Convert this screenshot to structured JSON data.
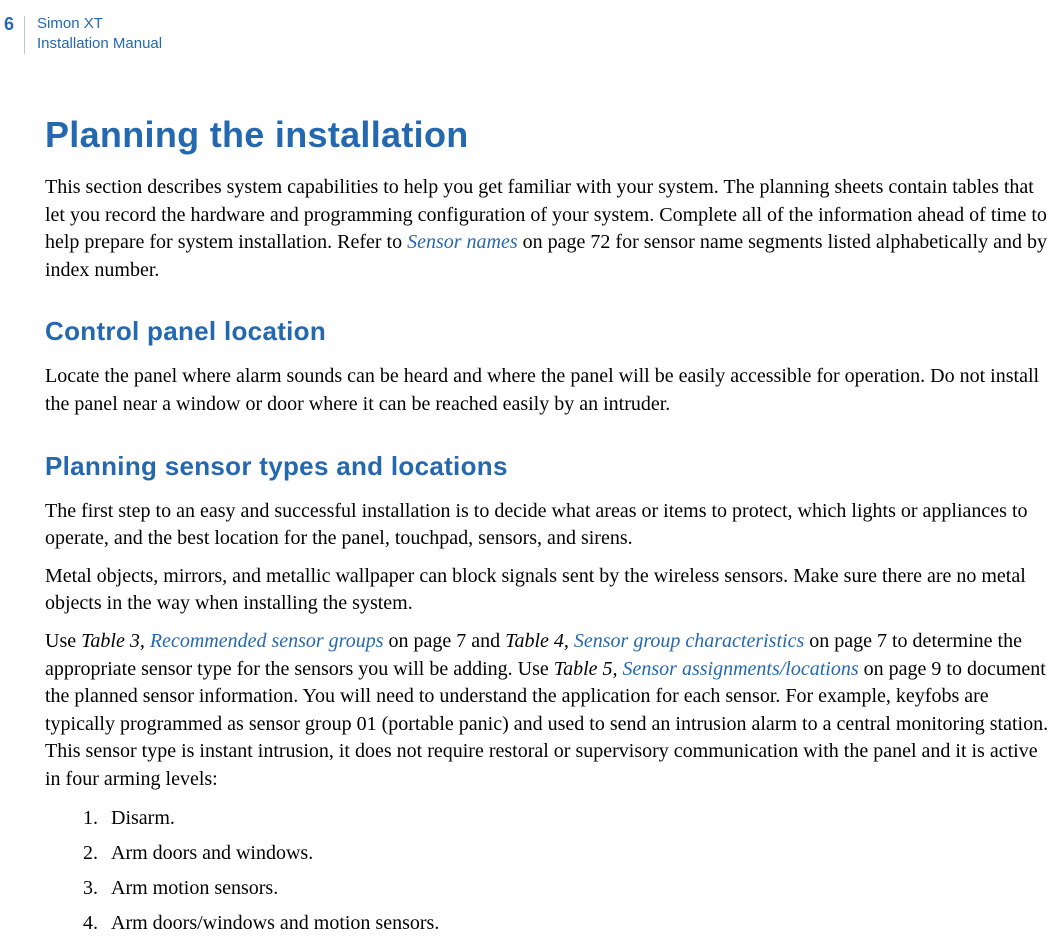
{
  "header": {
    "page_number": "6",
    "line1": "Simon XT",
    "line2": "Installation Manual"
  },
  "main": {
    "title": "Planning the installation",
    "intro_pre": "This section describes system capabilities to help you get familiar with your system. The planning sheets contain tables that let you record the hardware and programming configuration of your system. Complete all of the information ahead of time to help prepare for system installation. Refer to ",
    "intro_link": "Sensor names",
    "intro_post": " on page 72 for sensor name segments listed alphabetically and by index number.",
    "section1": {
      "heading": "Control panel location",
      "p1": "Locate the panel where alarm sounds can be heard and where the panel will be easily accessible for operation. Do not install the panel near a window or door where it can be reached easily by an intruder."
    },
    "section2": {
      "heading": "Planning sensor types and locations",
      "p1": "The first step to an easy and successful installation is to decide what areas or items to protect, which lights or appliances to operate, and the best location for the panel, touchpad, sensors, and sirens.",
      "p2": "Metal objects, mirrors, and metallic wallpaper can block signals sent by the wireless sensors. Make sure there are no metal objects in the way when installing the system.",
      "p3": {
        "t1": "Use ",
        "i1": "Table 3, ",
        "l1": "Recommended sensor groups",
        "t2": " on page 7 and ",
        "i2": "Table 4, ",
        "l2": "Sensor group characteristics",
        "t3": " on page 7 to determine the appropriate sensor type for the sensors you will be adding. Use ",
        "i3": "Table 5, ",
        "l3": "Sensor assignments/locations",
        "t4": " on page 9 to document the planned sensor information. You will need to understand the application for each sensor. For example, keyfobs are typically programmed as sensor group 01 (portable panic) and used to send an intrusion alarm to a central monitoring station. This sensor type is instant intrusion, it does not require restoral or supervisory communication with the panel and it is active in four arming levels:"
      },
      "list": [
        {
          "num": "1.",
          "text": "Disarm."
        },
        {
          "num": "2.",
          "text": "Arm doors and windows."
        },
        {
          "num": "3.",
          "text": "Arm motion sensors."
        },
        {
          "num": "4.",
          "text": "Arm doors/windows and motion sensors."
        }
      ]
    }
  }
}
